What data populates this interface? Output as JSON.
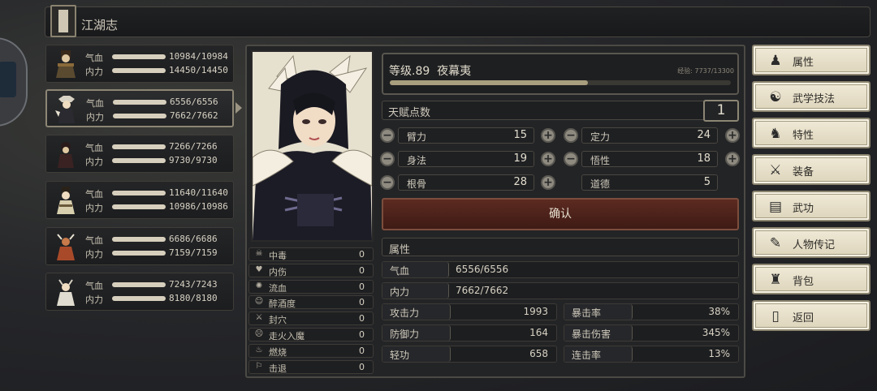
{
  "title": "江湖志",
  "characters": [
    {
      "hp_label": "气血",
      "hp": "10984/10984",
      "mp_label": "内力",
      "mp": "14450/14450",
      "selected": false
    },
    {
      "hp_label": "气血",
      "hp": "6556/6556",
      "mp_label": "内力",
      "mp": "7662/7662",
      "selected": true
    },
    {
      "hp_label": "气血",
      "hp": "7266/7266",
      "mp_label": "内力",
      "mp": "9730/9730",
      "selected": false
    },
    {
      "hp_label": "气血",
      "hp": "11640/11640",
      "mp_label": "内力",
      "mp": "10986/10986",
      "selected": false
    },
    {
      "hp_label": "气血",
      "hp": "6686/6686",
      "mp_label": "内力",
      "mp": "7159/7159",
      "selected": false
    },
    {
      "hp_label": "气血",
      "hp": "7243/7243",
      "mp_label": "内力",
      "mp": "8180/8180",
      "selected": false
    }
  ],
  "level": {
    "text": "等级.89",
    "name": "夜幕夷",
    "exp_text": "经验: 7737/13300",
    "exp_current": 7737,
    "exp_max": 13300
  },
  "talent": {
    "label": "天赋点数",
    "value": "1"
  },
  "stats": [
    {
      "label": "臂力",
      "value": "15"
    },
    {
      "label": "定力",
      "value": "24"
    },
    {
      "label": "身法",
      "value": "19"
    },
    {
      "label": "悟性",
      "value": "18"
    },
    {
      "label": "根骨",
      "value": "28"
    },
    {
      "label": "道德",
      "value": "5"
    }
  ],
  "confirm_label": "确认",
  "attributes": {
    "header": "属性",
    "hp": {
      "label": "气血",
      "value": "6556/6556"
    },
    "mp": {
      "label": "内力",
      "value": "7662/7662"
    },
    "pairs": [
      {
        "label": "攻击力",
        "value": "1993",
        "label2": "暴击率",
        "value2": "38%"
      },
      {
        "label": "防御力",
        "value": "164",
        "label2": "暴击伤害",
        "value2": "345%"
      },
      {
        "label": "轻功",
        "value": "658",
        "label2": "连击率",
        "value2": "13%"
      }
    ]
  },
  "statuses": [
    {
      "label": "中毒",
      "value": "0",
      "icon": "skull-icon"
    },
    {
      "label": "内伤",
      "value": "0",
      "icon": "broken-heart-icon"
    },
    {
      "label": "流血",
      "value": "0",
      "icon": "blood-icon"
    },
    {
      "label": "醉酒度",
      "value": "0",
      "icon": "drunk-icon"
    },
    {
      "label": "封穴",
      "value": "0",
      "icon": "acupoint-icon"
    },
    {
      "label": "走火入魔",
      "value": "0",
      "icon": "demon-icon"
    },
    {
      "label": "燃烧",
      "value": "0",
      "icon": "fire-icon"
    },
    {
      "label": "击退",
      "value": "0",
      "icon": "knockback-icon"
    }
  ],
  "menu": [
    {
      "label": "属性",
      "icon": "character-icon"
    },
    {
      "label": "武学技法",
      "icon": "martial-art-icon"
    },
    {
      "label": "特性",
      "icon": "trait-icon"
    },
    {
      "label": "装备",
      "icon": "sword-icon"
    },
    {
      "label": "武功",
      "icon": "manual-icon"
    },
    {
      "label": "人物传记",
      "icon": "biography-icon"
    },
    {
      "label": "背包",
      "icon": "bag-icon"
    },
    {
      "label": "返回",
      "icon": "door-icon"
    }
  ]
}
